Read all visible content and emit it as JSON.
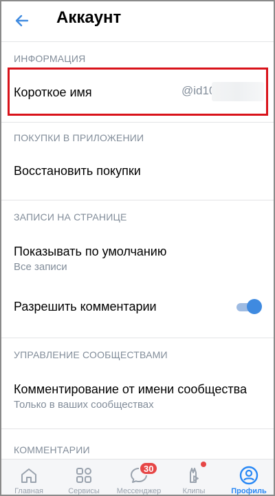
{
  "header": {
    "title": "Аккаунт"
  },
  "sections": {
    "info": {
      "heading": "ИНФОРМАЦИЯ",
      "short_name_label": "Короткое имя",
      "short_name_value": "@id10"
    },
    "purchases": {
      "heading": "ПОКУПКИ В ПРИЛОЖЕНИИ",
      "restore_label": "Восстановить покупки"
    },
    "wall": {
      "heading": "ЗАПИСИ НА СТРАНИЦЕ",
      "default_label": "Показывать по умолчанию",
      "default_value": "Все записи",
      "comments_label": "Разрешить комментарии",
      "comments_enabled": true
    },
    "communities": {
      "heading": "УПРАВЛЕНИЕ СООБЩЕСТВАМИ",
      "comment_as_label": "Комментирование от имени сообщества",
      "comment_as_value": "Только в ваших сообществах"
    },
    "comments": {
      "heading": "КОММЕНТАРИИ"
    }
  },
  "tabbar": {
    "items": [
      {
        "label": "Главная",
        "icon": "home-icon"
      },
      {
        "label": "Сервисы",
        "icon": "services-icon"
      },
      {
        "label": "Мессенджер",
        "icon": "messenger-icon",
        "badge": "30"
      },
      {
        "label": "Клипы",
        "icon": "clips-icon"
      },
      {
        "label": "Профиль",
        "icon": "profile-icon"
      }
    ],
    "active": "Профиль"
  },
  "colors": {
    "accent": "#3f8ae0",
    "highlight_border": "#d9121a",
    "secondary_text": "#818c99",
    "badge": "#e64646"
  }
}
